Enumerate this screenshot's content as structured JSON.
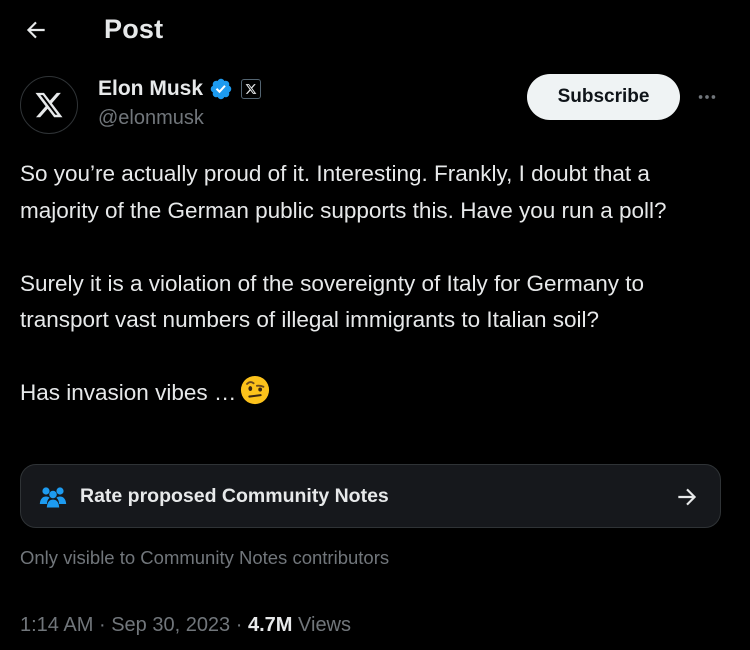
{
  "header": {
    "back_icon": "arrow-left-icon",
    "title": "Post"
  },
  "author": {
    "avatar_icon": "x-logo-icon",
    "display_name": "Elon Musk",
    "verified_icon": "verified-badge-icon",
    "affiliation_icon": "x-affiliate-badge-icon",
    "handle": "@elonmusk"
  },
  "actions": {
    "subscribe_label": "Subscribe",
    "more_icon": "ellipsis-icon"
  },
  "tweet": {
    "paragraphs": [
      "So you’re actually proud of it. Interesting. Frankly, I doubt that a majority of the German public supports this. Have you run a poll?",
      "Surely it is a violation of the sovereignty of Italy for Germany to transport vast numbers of illegal immigrants to Italian soil?",
      "Has invasion vibes …"
    ],
    "emoji_icon": "raised-eyebrow-emoji-icon"
  },
  "community_notes": {
    "icon": "community-people-icon",
    "label": "Rate proposed Community Notes",
    "arrow_icon": "arrow-right-icon",
    "visibility_text": "Only visible to Community Notes contributors"
  },
  "meta": {
    "time": "1:14 AM",
    "separator": "·",
    "date": "Sep 30, 2023",
    "views_count": "4.7M",
    "views_label": "Views"
  },
  "colors": {
    "background": "#000000",
    "text_primary": "#e7e9ea",
    "text_secondary": "#71767b",
    "verified_blue": "#1d9bf0",
    "card_bg": "#16181c",
    "border": "#2f3336"
  }
}
